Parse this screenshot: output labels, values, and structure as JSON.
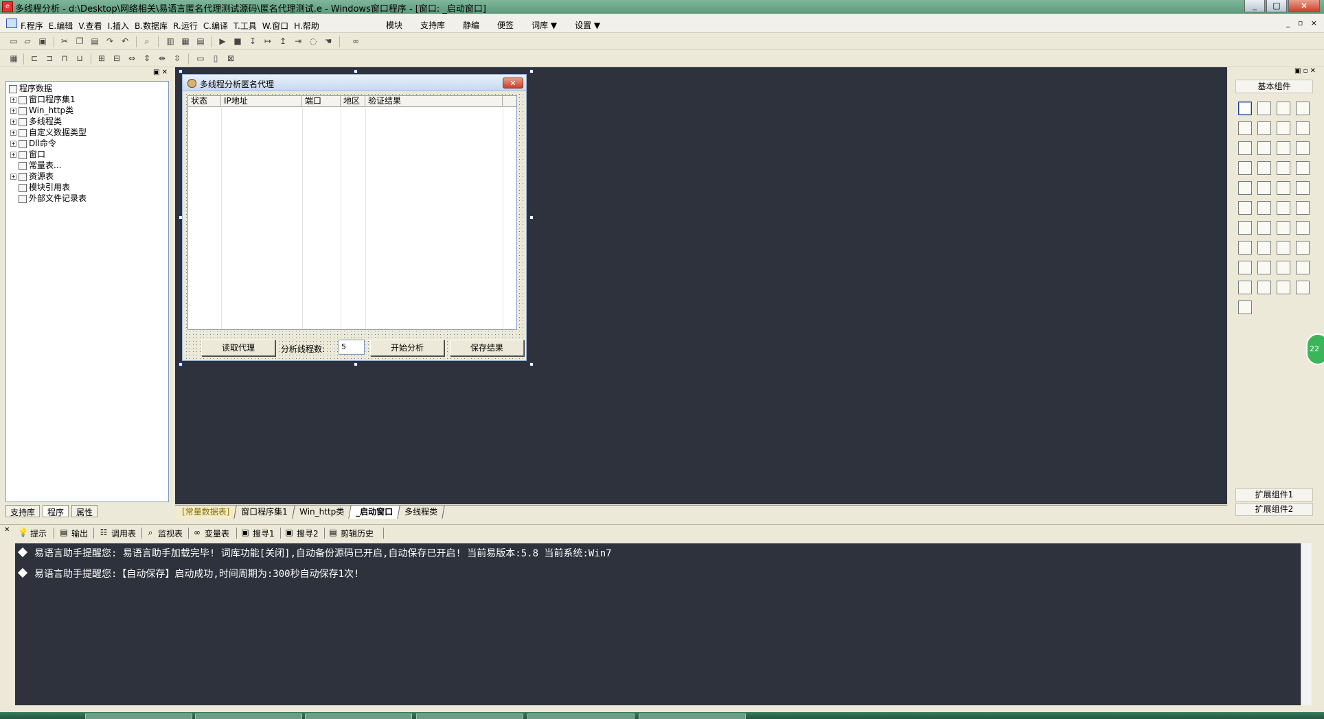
{
  "window": {
    "title": "多线程分析 - d:\\Desktop\\网络相关\\易语言匿名代理测试源码\\匿名代理测试.e - Windows窗口程序 - [窗口: _启动窗口]",
    "controls": [
      "_",
      "□",
      "×"
    ]
  },
  "menu": {
    "items": [
      "F.程序",
      "E.编辑",
      "V.查看",
      "I.插入",
      "B.数据库",
      "R.运行",
      "C.编译",
      "T.工具",
      "W.窗口",
      "H.帮助"
    ],
    "extra": [
      "模块",
      "支持库",
      "静编",
      "便签",
      "词库 ▼",
      "设置 ▼"
    ],
    "mdi_controls": "_ ▫ ×"
  },
  "tree": {
    "root": "程序数据",
    "items": [
      {
        "label": "窗口程序集1",
        "expandable": true
      },
      {
        "label": "Win_http类",
        "expandable": true
      },
      {
        "label": "多线程类",
        "expandable": true
      },
      {
        "label": "自定义数据类型",
        "expandable": true
      },
      {
        "label": "Dll命令",
        "expandable": true
      },
      {
        "label": "窗口",
        "expandable": true
      },
      {
        "label": "常量表...",
        "expandable": false
      },
      {
        "label": "资源表",
        "expandable": true
      },
      {
        "label": "模块引用表",
        "expandable": false
      },
      {
        "label": "外部文件记录表",
        "expandable": false
      }
    ]
  },
  "left_tabs": [
    "支持库",
    "程序",
    "属性"
  ],
  "form": {
    "title": "多线程分析匿名代理",
    "columns": [
      "状态",
      "IP地址",
      "端口",
      "地区",
      "验证结果"
    ],
    "buttons": {
      "read": "读取代理",
      "start": "开始分析",
      "save": "保存结果"
    },
    "thread_label": "分析线程数:",
    "thread_value": "5"
  },
  "toolbox": {
    "title": "基本组件",
    "ext1": "扩展组件1",
    "ext2": "扩展组件2"
  },
  "doc_tabs": [
    "[常量数据表]",
    "窗口程序集1",
    "Win_http类",
    "_启动窗口",
    "多线程类"
  ],
  "output_tabs": [
    "提示",
    "输出",
    "调用表",
    "监视表",
    "变量表",
    "搜寻1",
    "搜寻2",
    "剪辑历史"
  ],
  "output_lines": [
    "易语言助手提醒您:  易语言助手加载完毕!  词库功能[关闭],自动备份源码已开启,自动保存已开启!  当前易版本:5.8  当前系统:Win7",
    "易语言助手提醒您:【自动保存】启动成功,时间周期为:300秒自动保存1次!"
  ],
  "badge": "22",
  "colors": {
    "workspace": "#2d323d",
    "titlebar": "#5e9b7c",
    "form_title": "#c6d9f1"
  }
}
